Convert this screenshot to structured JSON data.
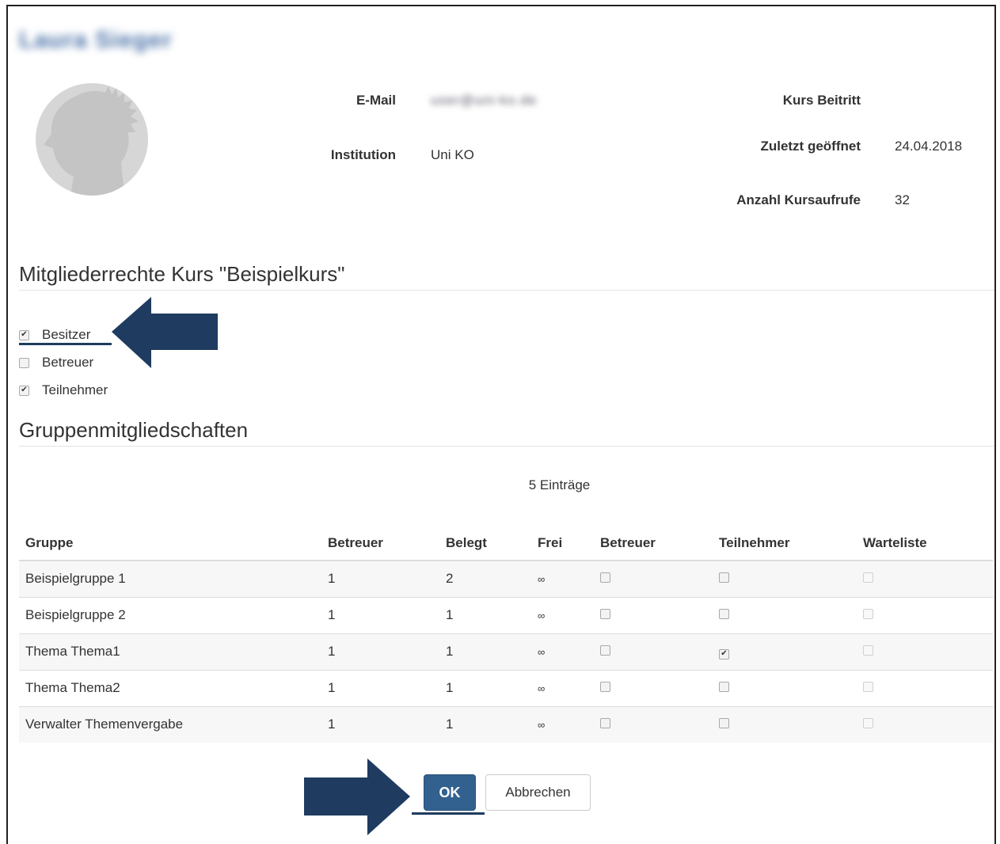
{
  "user": {
    "name": "Laura Sieger",
    "email_label": "E-Mail",
    "email_value": "user@uni-ko.de",
    "institution_label": "Institution",
    "institution_value": "Uni KO",
    "kurs_beitritt_label": "Kurs Beitritt",
    "kurs_beitritt_value": "",
    "zuletzt_label": "Zuletzt geöffnet",
    "zuletzt_value": "24.04.2018",
    "aufrufe_label": "Anzahl Kursaufrufe",
    "aufrufe_value": "32"
  },
  "rights": {
    "title": "Mitgliederrechte Kurs \"Beispielkurs\"",
    "roles": [
      {
        "label": "Besitzer",
        "checked": true
      },
      {
        "label": "Betreuer",
        "checked": false
      },
      {
        "label": "Teilnehmer",
        "checked": true
      }
    ]
  },
  "groups": {
    "title": "Gruppenmitgliedschaften",
    "entries": "5 Einträge",
    "columns": [
      "Gruppe",
      "Betreuer",
      "Belegt",
      "Frei",
      "Betreuer",
      "Teilnehmer",
      "Warteliste"
    ],
    "rows": [
      {
        "gruppe": "Beispielgruppe 1",
        "betreuer": "1",
        "belegt": "2",
        "frei": "∞",
        "cb_betreuer": false,
        "cb_teilnehmer": false,
        "cb_warteliste": false
      },
      {
        "gruppe": "Beispielgruppe 2",
        "betreuer": "1",
        "belegt": "1",
        "frei": "∞",
        "cb_betreuer": false,
        "cb_teilnehmer": false,
        "cb_warteliste": false
      },
      {
        "gruppe": "Thema Thema1",
        "betreuer": "1",
        "belegt": "1",
        "frei": "∞",
        "cb_betreuer": false,
        "cb_teilnehmer": true,
        "cb_warteliste": false
      },
      {
        "gruppe": "Thema Thema2",
        "betreuer": "1",
        "belegt": "1",
        "frei": "∞",
        "cb_betreuer": false,
        "cb_teilnehmer": false,
        "cb_warteliste": false
      },
      {
        "gruppe": "Verwalter Themenvergabe",
        "betreuer": "1",
        "belegt": "1",
        "frei": "∞",
        "cb_betreuer": false,
        "cb_teilnehmer": false,
        "cb_warteliste": false
      }
    ]
  },
  "buttons": {
    "ok_label": "OK",
    "cancel_label": "Abbrechen"
  },
  "icons": {
    "avatar": "user-silhouette-icon",
    "arrow_roles": "arrow-left-icon",
    "arrow_ok": "arrow-right-icon"
  },
  "colors": {
    "primary": "#33618f",
    "annotation": "#1f3b5f",
    "name": "#4c72a8"
  }
}
